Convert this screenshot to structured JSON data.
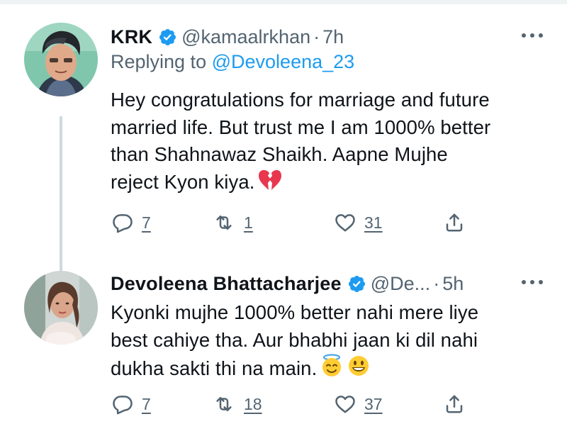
{
  "tweets": [
    {
      "author_name": "KRK",
      "verified": true,
      "handle": "@kamaalrkhan",
      "separator": "·",
      "time": "7h",
      "replying_prefix": "Replying to",
      "replying_to": "@Devoleena_23",
      "text_lines": [
        "Hey congratulations for marriage and future",
        "married life. But trust me I am 1000% better",
        "than Shahnawaz Shaikh. Aapne Mujhe",
        "reject Kyon kiya."
      ],
      "emojis": [
        "broken-heart"
      ],
      "replies": "7",
      "retweets": "1",
      "likes": "31"
    },
    {
      "author_name": "Devoleena Bhattacharjee",
      "verified": true,
      "handle": "@De...",
      "separator": "·",
      "time": "5h",
      "text_lines": [
        "Kyonki mujhe 1000% better nahi mere liye",
        "best cahiye tha. Aur bhabhi jaan ki dil nahi",
        "dukha sakti thi na main."
      ],
      "emojis": [
        "smiling-face-with-halo",
        "grinning-face"
      ],
      "replies": "7",
      "retweets": "18",
      "likes": "37"
    }
  ],
  "colors": {
    "text_primary": "#0f1419",
    "text_secondary": "#536471",
    "link": "#1d9bf0",
    "verified": "#1d9bf0",
    "thread_line": "#cfd9de",
    "broken_heart": "#e8384f",
    "emoji_yellow": "#ffcc33"
  }
}
